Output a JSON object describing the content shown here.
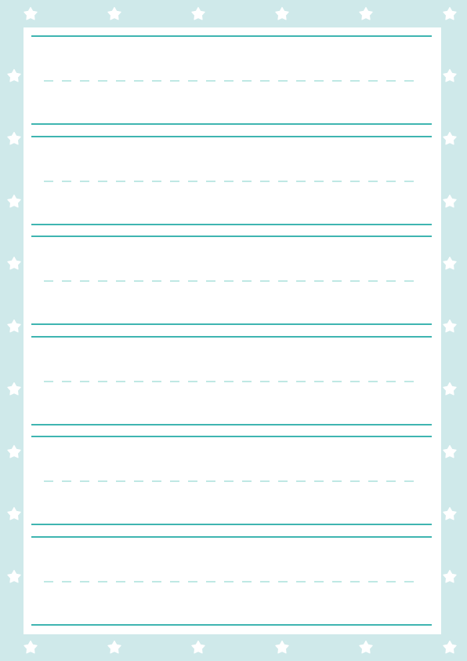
{
  "colors": {
    "border_background": "#cfe9ea",
    "star_fill": "#ffffff",
    "paper": "#ffffff",
    "ruling_line": "#3fb5b1",
    "midline_dash": "#bfe8e4"
  },
  "border": {
    "icon": "star-icon",
    "top_star_count": 6,
    "bottom_star_count": 6,
    "side_star_count_each": 9
  },
  "paper": {
    "row_count": 6,
    "rows": [
      {
        "row": 1,
        "guides": [
          "top-line",
          "dashed-midline",
          "base-line"
        ]
      },
      {
        "row": 2,
        "guides": [
          "top-line",
          "dashed-midline",
          "base-line"
        ]
      },
      {
        "row": 3,
        "guides": [
          "top-line",
          "dashed-midline",
          "base-line"
        ]
      },
      {
        "row": 4,
        "guides": [
          "top-line",
          "dashed-midline",
          "base-line"
        ]
      },
      {
        "row": 5,
        "guides": [
          "top-line",
          "dashed-midline",
          "base-line"
        ]
      },
      {
        "row": 6,
        "guides": [
          "top-line",
          "dashed-midline",
          "base-line"
        ]
      }
    ]
  }
}
